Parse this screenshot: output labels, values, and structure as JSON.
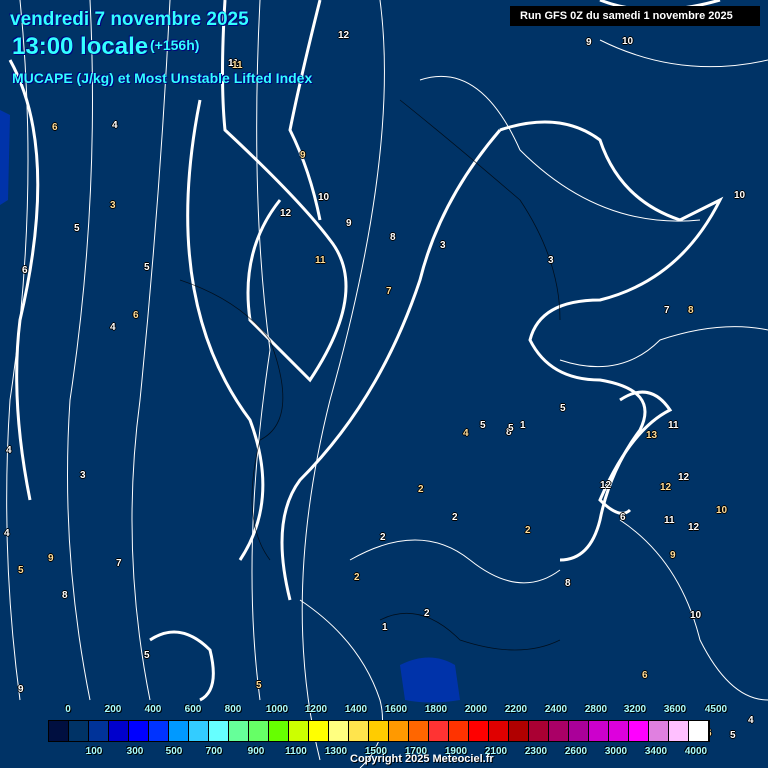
{
  "header": {
    "date": "vendredi 7 novembre 2025",
    "time": "13:00 locale",
    "lead": "(+156h)",
    "title": "MUCAPE (J/kg) et Most Unstable Lifted Index",
    "run": "Run GFS 0Z du samedi 1 novembre 2025"
  },
  "map": {
    "background_color": "#003366",
    "li_labels": [
      "12",
      "11",
      "9",
      "10",
      "12",
      "11",
      "9",
      "8",
      "7",
      "3",
      "3",
      "6",
      "4",
      "5",
      "3",
      "5",
      "4",
      "6",
      "3",
      "4",
      "9",
      "8",
      "7",
      "5",
      "6",
      "4",
      "4",
      "5",
      "8",
      "2",
      "2",
      "2",
      "2",
      "2",
      "1",
      "2",
      "1",
      "5",
      "5",
      "10",
      "9",
      "8",
      "7",
      "5",
      "13",
      "11",
      "12",
      "12",
      "11",
      "12",
      "10",
      "12",
      "6",
      "9",
      "8",
      "10",
      "6",
      "5",
      "4",
      "6",
      "9",
      "10",
      "11",
      "5"
    ]
  },
  "colorbar": {
    "colors": [
      "#000f40",
      "#003366",
      "#003399",
      "#0000cc",
      "#0000ff",
      "#0033ff",
      "#0099ff",
      "#33ccff",
      "#66ffff",
      "#66ff99",
      "#66ff66",
      "#66ff00",
      "#ccff00",
      "#ffff00",
      "#ffff80",
      "#ffe44d",
      "#ffcc00",
      "#ff9900",
      "#ff6600",
      "#ff3333",
      "#ff3300",
      "#ff0000",
      "#e00000",
      "#b00000",
      "#aa0033",
      "#aa0066",
      "#aa0099",
      "#cc00cc",
      "#dd00dd",
      "#ff00ff",
      "#e080e0",
      "#ffc0ff",
      "#ffffff"
    ],
    "top_labels": [
      "0",
      "200",
      "400",
      "600",
      "800",
      "1000",
      "1200",
      "1400",
      "1600",
      "1800",
      "2000",
      "2200",
      "2400",
      "2800",
      "3200",
      "3600",
      "4500"
    ],
    "bottom_labels": [
      "100",
      "300",
      "500",
      "700",
      "900",
      "1100",
      "1300",
      "1500",
      "1700",
      "1900",
      "2100",
      "2300",
      "2600",
      "3000",
      "3400",
      "4000"
    ]
  },
  "footer": {
    "copyright": "Copyright 2025 Meteociel.fr"
  }
}
